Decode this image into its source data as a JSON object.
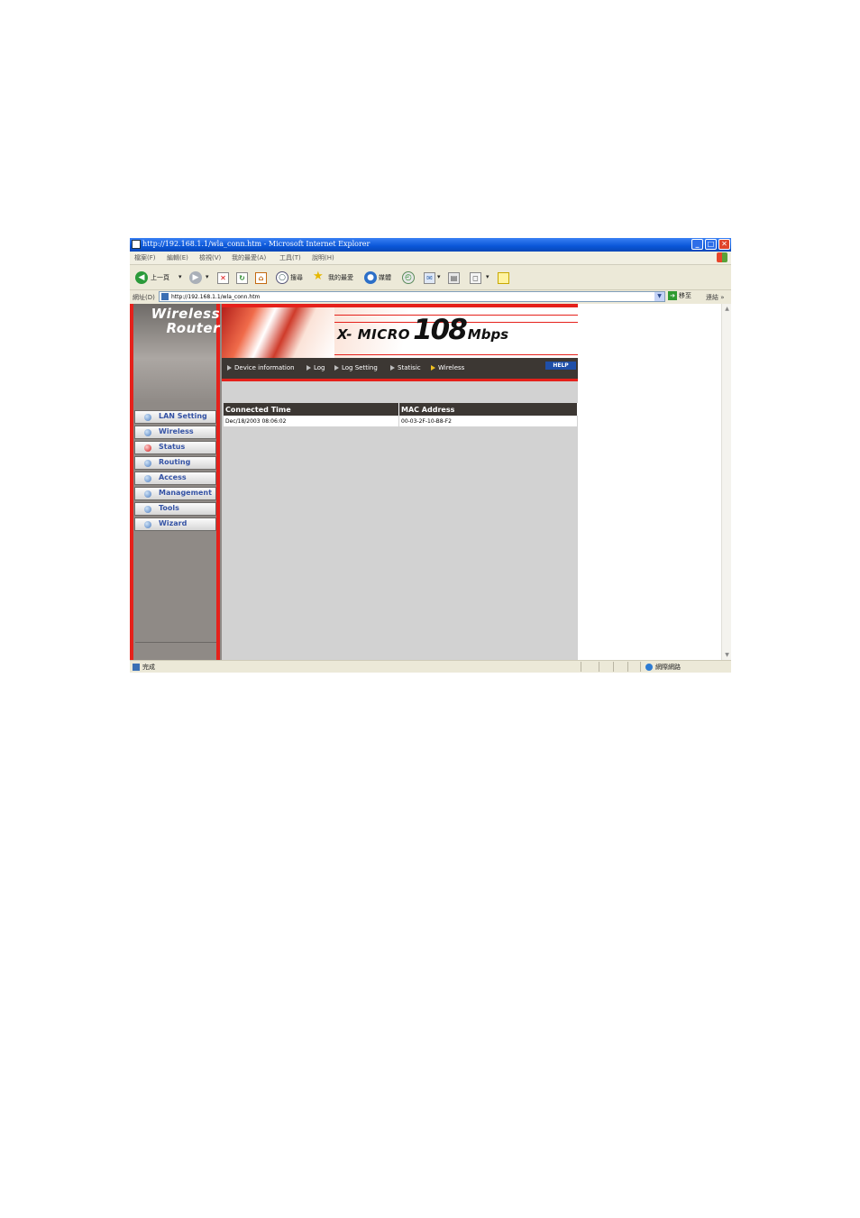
{
  "window": {
    "title": "http://192.168.1.1/wla_conn.htm - Microsoft Internet Explorer",
    "buttons": {
      "minimize": "_",
      "maximize": "□",
      "close": "✕"
    }
  },
  "menubar": {
    "items": [
      "檔案(F)",
      "編輯(E)",
      "檢視(V)",
      "我的最愛(A)",
      "工具(T)",
      "說明(H)"
    ]
  },
  "toolbar": {
    "back_label": "上一頁",
    "search_label": "搜尋",
    "favorites_label": "我的最愛",
    "media_label": "媒體"
  },
  "addressbar": {
    "label": "網址(D)",
    "url": "http://192.168.1.1/wla_conn.htm",
    "go_label": "移至",
    "links_label": "連結",
    "more": "»"
  },
  "router": {
    "brand_line1": "Wireless",
    "brand_line2": "Router",
    "logo": {
      "xm": "X- MICRO",
      "big": "108",
      "mb": "Mbps"
    },
    "nav": [
      {
        "label": "LAN Setting",
        "active": false
      },
      {
        "label": "Wireless",
        "active": false
      },
      {
        "label": "Status",
        "active": true
      },
      {
        "label": "Routing",
        "active": false
      },
      {
        "label": "Access",
        "active": false
      },
      {
        "label": "Management",
        "active": false
      },
      {
        "label": "Tools",
        "active": false
      },
      {
        "label": "Wizard",
        "active": false
      }
    ],
    "tabs": [
      "Device information",
      "Log",
      "Log Setting",
      "Statisic",
      "Wireless"
    ],
    "active_tab": "Wireless",
    "help_label": "HELP",
    "table": {
      "headers": [
        "Connected Time",
        "MAC Address"
      ],
      "rows": [
        [
          "Dec/18/2003 08:06:02",
          "00-03-2F-10-B8-F2"
        ]
      ]
    },
    "colors": {
      "accent_red": "#e5211b",
      "dark_bar": "#3c3733",
      "nav_text": "#3553a5"
    }
  },
  "statusbar": {
    "status_text": "完成",
    "zone_text": "網際網路"
  }
}
